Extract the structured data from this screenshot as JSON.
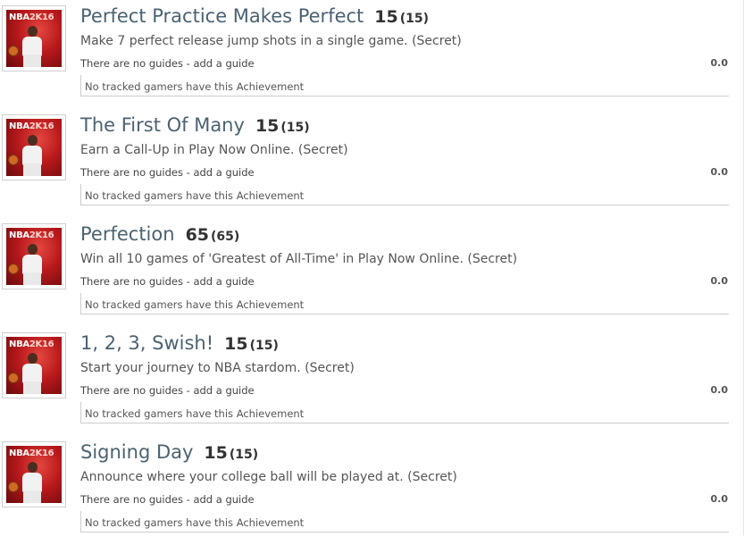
{
  "achievements": [
    {
      "title": "Perfect Practice Makes Perfect",
      "score": "15",
      "max": "(15)",
      "description": "Make 7 perfect release jump shots in a single game. (Secret)",
      "guides_text": "There are no guides",
      "add_guide": "add a guide",
      "rating": "0.0",
      "tracked": "No tracked gamers have this Achievement"
    },
    {
      "title": "The First Of Many",
      "score": "15",
      "max": "(15)",
      "description": "Earn a Call-Up in Play Now Online. (Secret)",
      "guides_text": "There are no guides",
      "add_guide": "add a guide",
      "rating": "0.0",
      "tracked": "No tracked gamers have this Achievement"
    },
    {
      "title": "Perfection",
      "score": "65",
      "max": "(65)",
      "description": "Win all 10 games of 'Greatest of All-Time' in Play Now Online. (Secret)",
      "guides_text": "There are no guides",
      "add_guide": "add a guide",
      "rating": "0.0",
      "tracked": "No tracked gamers have this Achievement"
    },
    {
      "title": "1, 2, 3, Swish!",
      "score": "15",
      "max": "(15)",
      "description": "Start your journey to NBA stardom. (Secret)",
      "guides_text": "There are no guides",
      "add_guide": "add a guide",
      "rating": "0.0",
      "tracked": "No tracked gamers have this Achievement"
    },
    {
      "title": "Signing Day",
      "score": "15",
      "max": "(15)",
      "description": "Announce where your college ball will be played at. (Secret)",
      "guides_text": "There are no guides",
      "add_guide": "add a guide",
      "rating": "0.0",
      "tracked": "No tracked gamers have this Achievement"
    }
  ],
  "game_art": {
    "logo_text": "NBA",
    "logo_suffix": "2K16",
    "icon": "nba2k16-cover-thumbnail"
  },
  "colors": {
    "title": "#4b6270",
    "score": "#333333",
    "border": "#cccccc",
    "art_red": "#b8191c"
  }
}
